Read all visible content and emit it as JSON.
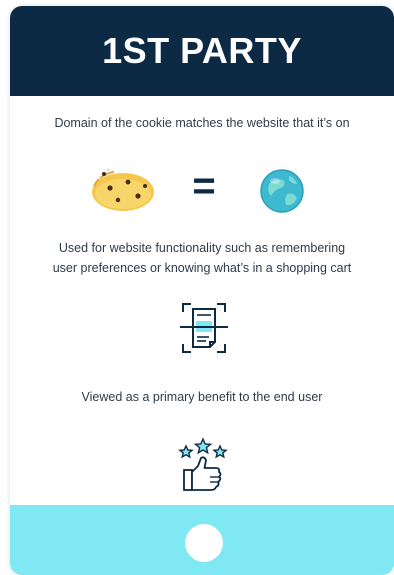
{
  "header": {
    "title": "1ST PARTY"
  },
  "point1": {
    "text": "Domain of the cookie matches the website that it’s on"
  },
  "equation": {
    "left_icon": "cookie-icon",
    "operator": "=",
    "right_icon": "globe-icon"
  },
  "point2": {
    "line1": "Used for website functionality such as remembering",
    "line2": "user preferences or knowing what’s in a shopping cart",
    "icon": "scanner-document-icon"
  },
  "point3": {
    "text": "Viewed as a primary benefit to the end user",
    "icon": "thumbs-up-stars-icon"
  },
  "colors": {
    "header_bg": "#0d2a45",
    "accent_cyan": "#80e8f3",
    "text": "#2e3b48"
  }
}
